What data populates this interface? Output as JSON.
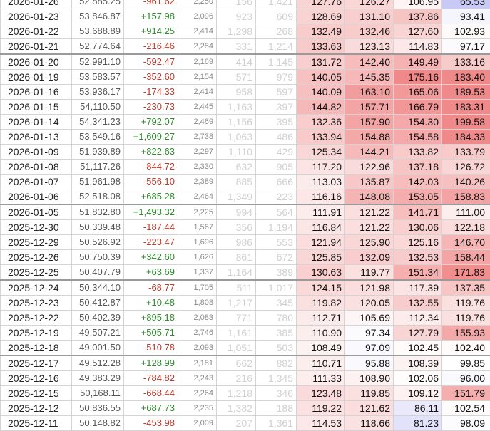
{
  "rows": [
    {
      "date": "2026-01-26",
      "close": "52,885.25",
      "change": "-961.62",
      "volume": "2,250",
      "n1": "156",
      "n2": "1,421",
      "v": [
        "127.76",
        "126.27",
        "106.95",
        "65.53"
      ]
    },
    {
      "date": "2026-01-23",
      "close": "53,846.87",
      "change": "+157.98",
      "volume": "2,096",
      "n1": "923",
      "n2": "609",
      "v": [
        "128.69",
        "131.10",
        "137.86",
        "93.41"
      ]
    },
    {
      "date": "2026-01-22",
      "close": "53,688.89",
      "change": "+914.25",
      "volume": "2,414",
      "n1": "1,298",
      "n2": "268",
      "v": [
        "132.49",
        "132.46",
        "127.60",
        "102.93"
      ]
    },
    {
      "date": "2026-01-21",
      "close": "52,774.64",
      "change": "-216.46",
      "volume": "2,284",
      "n1": "331",
      "n2": "1,214",
      "v": [
        "133.63",
        "123.13",
        "114.83",
        "97.17"
      ]
    },
    {
      "date": "2026-01-20",
      "close": "52,991.10",
      "change": "-592.47",
      "volume": "2,169",
      "n1": "414",
      "n2": "1,145",
      "v": [
        "131.72",
        "142.40",
        "149.49",
        "133.16"
      ]
    },
    {
      "date": "2026-01-19",
      "close": "53,583.57",
      "change": "-352.60",
      "volume": "2,154",
      "n1": "571",
      "n2": "979",
      "v": [
        "140.05",
        "145.35",
        "175.16",
        "183.40"
      ]
    },
    {
      "date": "2026-01-16",
      "close": "53,936.17",
      "change": "-174.33",
      "volume": "2,414",
      "n1": "958",
      "n2": "597",
      "v": [
        "140.09",
        "163.10",
        "165.06",
        "189.53"
      ]
    },
    {
      "date": "2026-01-15",
      "close": "54,110.50",
      "change": "-230.73",
      "volume": "2,445",
      "n1": "1,163",
      "n2": "397",
      "v": [
        "144.82",
        "157.71",
        "166.79",
        "183.31"
      ]
    },
    {
      "date": "2026-01-14",
      "close": "54,341.23",
      "change": "+792.07",
      "volume": "2,469",
      "n1": "1,156",
      "n2": "395",
      "v": [
        "132.36",
        "157.90",
        "154.30",
        "199.58"
      ]
    },
    {
      "date": "2026-01-13",
      "close": "53,549.16",
      "change": "+1,609.27",
      "volume": "2,738",
      "n1": "1,063",
      "n2": "486",
      "v": [
        "133.94",
        "154.88",
        "154.58",
        "184.33"
      ]
    },
    {
      "date": "2026-01-09",
      "close": "51,939.89",
      "change": "+822.63",
      "volume": "2,297",
      "n1": "1,110",
      "n2": "429",
      "v": [
        "125.34",
        "144.21",
        "133.82",
        "133.79"
      ]
    },
    {
      "date": "2026-01-08",
      "close": "51,117.26",
      "change": "-844.72",
      "volume": "2,330",
      "n1": "632",
      "n2": "905",
      "v": [
        "117.20",
        "122.96",
        "137.18",
        "126.72"
      ]
    },
    {
      "date": "2026-01-07",
      "close": "51,961.98",
      "change": "-556.10",
      "volume": "2,389",
      "n1": "885",
      "n2": "666",
      "v": [
        "113.03",
        "135.87",
        "142.03",
        "140.26"
      ]
    },
    {
      "date": "2026-01-06",
      "close": "52,518.08",
      "change": "+685.28",
      "volume": "2,464",
      "n1": "1,349",
      "n2": "223",
      "v": [
        "116.16",
        "148.08",
        "153.05",
        "158.83"
      ]
    },
    {
      "date": "2026-01-05",
      "close": "51,832.80",
      "change": "+1,493.32",
      "volume": "2,225",
      "n1": "994",
      "n2": "564",
      "v": [
        "111.91",
        "121.22",
        "141.71",
        "111.00"
      ]
    },
    {
      "date": "2025-12-30",
      "close": "50,339.48",
      "change": "-187.44",
      "volume": "1,567",
      "n1": "356",
      "n2": "1,194",
      "v": [
        "116.84",
        "121.22",
        "130.06",
        "122.18"
      ]
    },
    {
      "date": "2025-12-29",
      "close": "50,526.92",
      "change": "-223.47",
      "volume": "1,696",
      "n1": "986",
      "n2": "553",
      "v": [
        "121.94",
        "125.90",
        "125.16",
        "146.70"
      ]
    },
    {
      "date": "2025-12-26",
      "close": "50,750.39",
      "change": "+342.60",
      "volume": "1,626",
      "n1": "861",
      "n2": "672",
      "v": [
        "125.85",
        "132.09",
        "132.53",
        "158.44"
      ]
    },
    {
      "date": "2025-12-25",
      "close": "50,407.79",
      "change": "+63.69",
      "volume": "1,337",
      "n1": "1,164",
      "n2": "389",
      "v": [
        "130.63",
        "119.77",
        "151.34",
        "171.83"
      ]
    },
    {
      "date": "2025-12-24",
      "close": "50,344.10",
      "change": "-68.77",
      "volume": "1,705",
      "n1": "511",
      "n2": "1,017",
      "v": [
        "124.15",
        "121.98",
        "117.39",
        "137.35"
      ]
    },
    {
      "date": "2025-12-23",
      "close": "50,412.87",
      "change": "+10.48",
      "volume": "1,808",
      "n1": "1,217",
      "n2": "345",
      "v": [
        "119.82",
        "120.05",
        "132.55",
        "119.76"
      ]
    },
    {
      "date": "2025-12-22",
      "close": "50,402.39",
      "change": "+895.18",
      "volume": "2,083",
      "n1": "771",
      "n2": "780",
      "v": [
        "112.71",
        "105.69",
        "112.34",
        "119.76"
      ]
    },
    {
      "date": "2025-12-19",
      "close": "49,507.21",
      "change": "+505.71",
      "volume": "2,746",
      "n1": "1,161",
      "n2": "385",
      "v": [
        "110.90",
        "97.34",
        "127.79",
        "155.93"
      ]
    },
    {
      "date": "2025-12-18",
      "close": "49,001.50",
      "change": "-510.78",
      "volume": "2,093",
      "n1": "1,051",
      "n2": "503",
      "v": [
        "108.49",
        "97.09",
        "102.45",
        "102.40"
      ]
    },
    {
      "date": "2025-12-17",
      "close": "49,512.28",
      "change": "+128.99",
      "volume": "2,181",
      "n1": "662",
      "n2": "882",
      "v": [
        "110.71",
        "95.88",
        "108.39",
        "99.85"
      ]
    },
    {
      "date": "2025-12-16",
      "close": "49,383.29",
      "change": "-784.82",
      "volume": "2,243",
      "n1": "216",
      "n2": "1,345",
      "v": [
        "111.33",
        "108.90",
        "102.06",
        "96.00"
      ]
    },
    {
      "date": "2025-12-15",
      "close": "50,168.11",
      "change": "-668.44",
      "volume": "2,264",
      "n1": "1,218",
      "n2": "346",
      "v": [
        "123.48",
        "119.85",
        "109.12",
        "151.79"
      ]
    },
    {
      "date": "2025-12-12",
      "close": "50,836.55",
      "change": "+687.73",
      "volume": "2,235",
      "n1": "1,382",
      "n2": "188",
      "v": [
        "119.22",
        "121.62",
        "86.11",
        "102.54"
      ]
    },
    {
      "date": "2025-12-11",
      "close": "50,148.82",
      "change": "-453.98",
      "volume": "2,009",
      "n1": "207",
      "n2": "1,361",
      "v": [
        "114.53",
        "118.66",
        "81.23",
        "98.09"
      ]
    }
  ],
  "separator_rows": [
    4,
    14,
    19,
    24
  ],
  "colors": {
    "up": "#2e8b2e",
    "down": "#c0392b",
    "heat_high": "#f08a8a",
    "heat_low": "#c8c8f5",
    "neutral": "#ffffff"
  }
}
